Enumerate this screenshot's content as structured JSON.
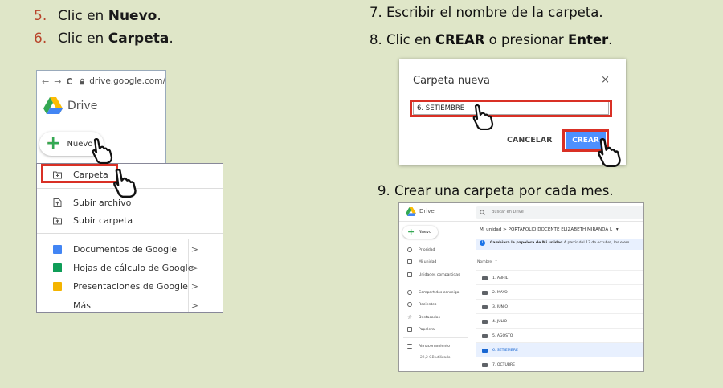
{
  "steps_left": [
    {
      "number": "5.",
      "pre": "Clic en ",
      "bold": "Nuevo",
      "post": "."
    },
    {
      "number": "6.",
      "pre": "Clic en ",
      "bold": "Carpeta",
      "post": "."
    }
  ],
  "step7": "7. Escribir el nombre de la carpeta.",
  "step8": {
    "pre": "8. Clic en ",
    "bold1": "CREAR",
    "mid": " o presionar ",
    "bold2": "Enter",
    "post": "."
  },
  "step9": "9. Crear una carpeta por cada  mes.",
  "browser": {
    "back": "←",
    "forward": "→",
    "reload": "C",
    "url": "drive.google.com/",
    "app_title": "Drive",
    "new_button": "Nuevo"
  },
  "new_menu": {
    "items": [
      {
        "label": "Carpeta"
      },
      {
        "label": "Subir archivo"
      },
      {
        "label": "Subir carpeta"
      },
      {
        "label": "Documentos de Google",
        "arrow": ">"
      },
      {
        "label": "Hojas de cálculo de Google",
        "arrow": ">"
      },
      {
        "label": "Presentaciones de Google",
        "arrow": ">"
      },
      {
        "label": "Más",
        "arrow": ">"
      }
    ]
  },
  "dialog": {
    "title": "Carpeta nueva",
    "close": "×",
    "input_value": "6. SETIEMBRE",
    "cancel": "CANCELAR",
    "create": "CREAR"
  },
  "drive_window": {
    "app_title": "Drive",
    "search_placeholder": "Buscar en Drive",
    "new_button": "Nuevo",
    "sidebar": [
      "Prioridad",
      "Mi unidad",
      "Unidades compartidas",
      "Compartidos conmigo",
      "Recientes",
      "Destacados",
      "Papelera",
      "Almacenamiento"
    ],
    "storage_used": "22,2 GB utilizado",
    "breadcrumb": "Mi unidad  >  PORTAFOLIO DOCENTE ELIZABETH MIRANDA L",
    "breadcrumb_caret": "▾",
    "notice_bold": "Cambiará la papelera de Mi unidad",
    "notice_rest": "A partir del 13 de octubre, los elem",
    "sort_label": "Nombre",
    "sort_icon": "↑",
    "folders": [
      "1. ABRIL",
      "2. MAYO",
      "3. JUNIO",
      "4. JULIO",
      "5. AGOSTO",
      "6. SETIEMBRE",
      "7. OCTUBRE"
    ],
    "selected_folder": "6. SETIEMBRE"
  },
  "colors": {
    "background": "#dfe6c8",
    "step_number": "#b8442a",
    "highlight_red": "#d93025",
    "create_blue": "#4d90fe"
  }
}
